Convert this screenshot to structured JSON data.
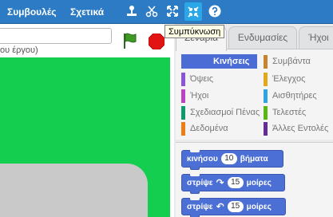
{
  "menu": {
    "tips": "Συμβουλές",
    "about": "Σχετικά"
  },
  "toolbar": {
    "icons": [
      "duplicate-icon",
      "cut-icon",
      "grow-icon",
      "shrink-icon",
      "help-icon"
    ],
    "tooltip": "Συμπύκνωση"
  },
  "project": {
    "byline": "ου έργου)"
  },
  "tabs": [
    {
      "label": "Σενάρια",
      "active": true
    },
    {
      "label": "Ενδυμασίες",
      "active": false
    },
    {
      "label": "Ήχοι",
      "active": false
    }
  ],
  "categories": [
    {
      "label": "Κινήσεις",
      "color": "#4a6cd4",
      "selected": true
    },
    {
      "label": "Συμβάντα",
      "color": "#c88330"
    },
    {
      "label": "Όψεις",
      "color": "#8a55d7"
    },
    {
      "label": "Έλεγχος",
      "color": "#e1a91a"
    },
    {
      "label": "Ήχοι",
      "color": "#bb42c3"
    },
    {
      "label": "Αισθητήρες",
      "color": "#2ca5e2"
    },
    {
      "label": "Σχεδιασμοί Πένας",
      "color": "#0e9a6c"
    },
    {
      "label": "Τελεστές",
      "color": "#5cb712"
    },
    {
      "label": "Δεδομένα",
      "color": "#ee7d16"
    },
    {
      "label": "Άλλες Εντολές",
      "color": "#632d99"
    }
  ],
  "blocks": [
    {
      "prefix": "κινήσου",
      "value": "10",
      "suffix": "βήματα",
      "icon": ""
    },
    {
      "prefix": "στρίψε",
      "value": "15",
      "suffix": "μοίρες",
      "icon": "↷"
    },
    {
      "prefix": "στρίψε",
      "value": "15",
      "suffix": "μοίρες",
      "icon": "↶"
    }
  ],
  "colors": {
    "menubar": "#2c7bc4",
    "stage": "#13ce4f",
    "motion": "#4c6fd6"
  }
}
